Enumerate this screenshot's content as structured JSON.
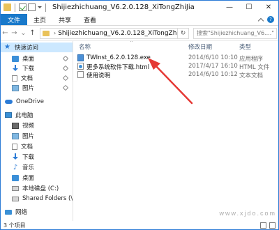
{
  "window": {
    "title": "Shijiezhichuang_V6.2.0.128_XiTongZhiJia"
  },
  "ribbon": {
    "tabs": [
      "文件",
      "主页",
      "共享",
      "查看"
    ]
  },
  "address": {
    "path": "Shijiezhichuang_V6.2.0.128_XiTongZhiJi...",
    "search_placeholder": "搜索\"Shijiezhichuang_V6....\""
  },
  "nav": {
    "quick_access": "快速访问",
    "quick_items": [
      "桌面",
      "下载",
      "文档",
      "图片"
    ],
    "onedrive": "OneDrive",
    "this_pc": "此电脑",
    "pc_items": [
      "视频",
      "图片",
      "文档",
      "下载",
      "音乐",
      "桌面",
      "本地磁盘 (C:)",
      "Shared Folders (\\\\v"
    ],
    "network": "网络"
  },
  "files": {
    "headers": {
      "name": "名称",
      "date": "修改日期",
      "type": "类型"
    },
    "rows": [
      {
        "name": "TWInst_6.2.0.128.exe",
        "date": "2014/6/10 10:10",
        "type": "应用程序",
        "icon": "exe-icon"
      },
      {
        "name": "更多系统软件下载.html",
        "date": "2017/4/17 16:10",
        "type": "HTML 文件",
        "icon": "html-icon"
      },
      {
        "name": "使用说明",
        "date": "2014/6/10 10:12",
        "type": "文本文档",
        "icon": "text-file-icon"
      }
    ]
  },
  "status": {
    "count": "3 个项目"
  },
  "watermark": "www.xjdo.com",
  "colors": {
    "accent": "#1979ca",
    "selection": "#cce8ff",
    "arrow": "#e53935"
  }
}
